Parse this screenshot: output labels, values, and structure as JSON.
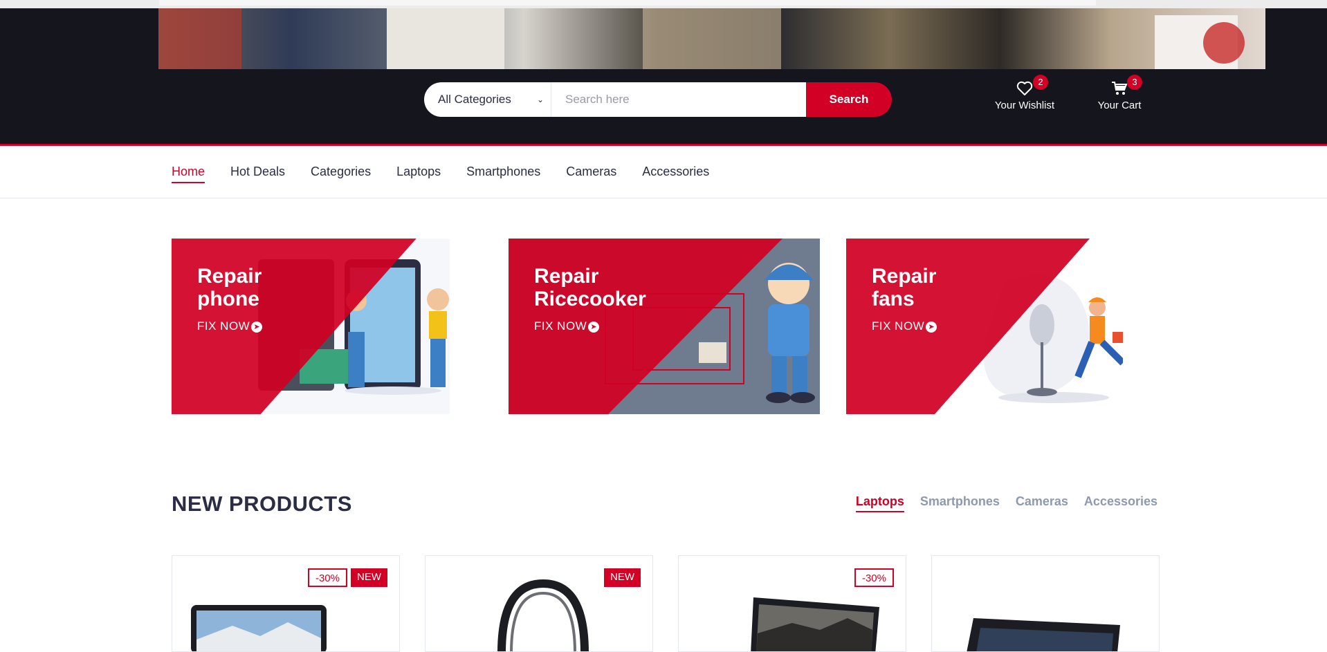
{
  "header": {
    "search": {
      "category_selected": "All Categories",
      "placeholder": "Search here",
      "button_label": "Search"
    },
    "wishlist": {
      "label": "Your Wishlist",
      "count": "2",
      "icon": "heart-icon"
    },
    "cart": {
      "label": "Your Cart",
      "count": "3",
      "icon": "cart-icon"
    }
  },
  "nav": {
    "items": [
      "Home",
      "Hot Deals",
      "Categories",
      "Laptops",
      "Smartphones",
      "Cameras",
      "Accessories"
    ],
    "active": "Home"
  },
  "promos": [
    {
      "title": "Repair\nphone",
      "cta": "FIX NOW"
    },
    {
      "title": "Repair\nRicecooker",
      "cta": "FIX NOW"
    },
    {
      "title": "Repair\nfans",
      "cta": "FIX NOW"
    }
  ],
  "new_products": {
    "title": "NEW PRODUCTS",
    "tabs": [
      "Laptops",
      "Smartphones",
      "Cameras",
      "Accessories"
    ],
    "active_tab": "Laptops",
    "products": [
      {
        "sale": "-30%",
        "new": "NEW"
      },
      {
        "new": "NEW"
      },
      {
        "sale": "-30%"
      },
      {}
    ]
  },
  "colors": {
    "accent": "#d10024",
    "header_bg": "#15161d",
    "text": "#2b2d42",
    "muted": "#8d99ae"
  }
}
